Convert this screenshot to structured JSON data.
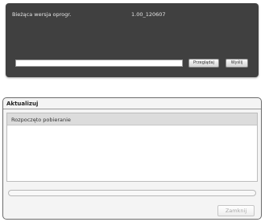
{
  "firmware": {
    "current_version_label": "Bieżąca wersja oprogr.",
    "current_version_value": "1.00_120607",
    "file_input_value": "",
    "browse_label": "Przeglądaj",
    "send_label": "Wyślij"
  },
  "update_dialog": {
    "title": "Aktualizuj",
    "log_entries": [
      "Rozpoczęto pobieranie"
    ],
    "progress": 0,
    "close_label": "Zamknij"
  }
}
